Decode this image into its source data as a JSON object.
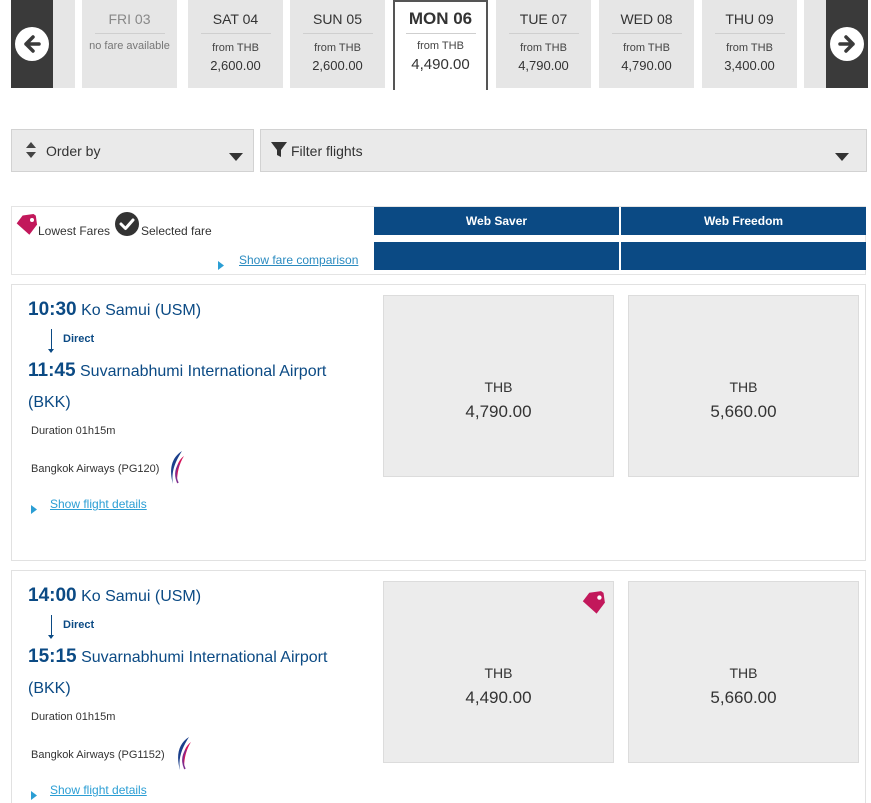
{
  "carousel": {
    "days": [
      {
        "day": "FRI 03",
        "note": "no fare available",
        "from": "",
        "price": ""
      },
      {
        "day": "SAT 04",
        "note": "",
        "from": "from THB",
        "price": "2,600.00"
      },
      {
        "day": "SUN 05",
        "note": "",
        "from": "from THB",
        "price": "2,600.00"
      },
      {
        "day": "MON 06",
        "note": "",
        "from": "from THB",
        "price": "4,490.00"
      },
      {
        "day": "TUE 07",
        "note": "",
        "from": "from THB",
        "price": "4,790.00"
      },
      {
        "day": "WED 08",
        "note": "",
        "from": "from THB",
        "price": "4,790.00"
      },
      {
        "day": "THU 09",
        "note": "",
        "from": "from THB",
        "price": "3,400.00"
      }
    ]
  },
  "controls": {
    "order_label": "Order by",
    "filter_label": "Filter flights"
  },
  "legend": {
    "lowest": "Lowest Fares",
    "selected": "Selected fare",
    "compare": "Show fare comparison"
  },
  "fare_columns": [
    "Web Saver",
    "Web Freedom"
  ],
  "flights": [
    {
      "dep_time": "10:30",
      "dep_place": "Ko Samui (USM)",
      "stop": "Direct",
      "arr_time": "11:45",
      "arr_place": "Suvarnabhumi International Airport (BKK)",
      "duration": "Duration 01h15m",
      "airline": "Bangkok Airways (PG120)",
      "details": "Show flight details",
      "fares": [
        {
          "currency": "THB",
          "amount": "4,790.00",
          "lowest": false
        },
        {
          "currency": "THB",
          "amount": "5,660.00",
          "lowest": false
        }
      ]
    },
    {
      "dep_time": "14:00",
      "dep_place": "Ko Samui (USM)",
      "stop": "Direct",
      "arr_time": "15:15",
      "arr_place": "Suvarnabhumi International Airport (BKK)",
      "duration": "Duration 01h15m",
      "airline": "Bangkok Airways (PG1152)",
      "details": "Show flight details",
      "fares": [
        {
          "currency": "THB",
          "amount": "4,490.00",
          "lowest": true
        },
        {
          "currency": "THB",
          "amount": "5,660.00",
          "lowest": false
        }
      ]
    }
  ],
  "colors": {
    "primary": "#0b4a84",
    "link": "#2b9ed4",
    "tag": "#c2185b"
  }
}
